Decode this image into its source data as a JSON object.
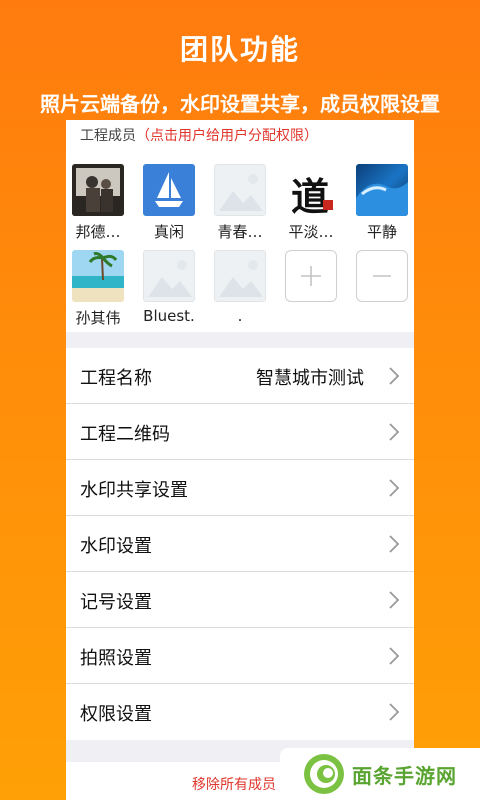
{
  "promo": {
    "title": "团队功能",
    "subtitle": "照片云端备份，水印设置共享，成员权限设置"
  },
  "members": {
    "header_label": "工程成员",
    "header_hint": "（点击用户给用户分配权限）",
    "list": [
      {
        "name": "邦德…",
        "avatar": "photo-dark"
      },
      {
        "name": "真闲",
        "avatar": "sailboat"
      },
      {
        "name": "青春…",
        "avatar": "placeholder"
      },
      {
        "name": "平淡…",
        "avatar": "calligraphy"
      },
      {
        "name": "平静",
        "avatar": "wave"
      },
      {
        "name": "孙其伟",
        "avatar": "beach"
      },
      {
        "name": "Bluest.",
        "avatar": "placeholder"
      },
      {
        "name": ".",
        "avatar": "placeholder"
      }
    ],
    "calligraphy_char": "道",
    "add_symbol": "+",
    "remove_symbol": "−"
  },
  "settings": {
    "rows": [
      {
        "label": "工程名称",
        "value": "智慧城市测试"
      },
      {
        "label": "工程二维码",
        "value": ""
      },
      {
        "label": "水印共享设置",
        "value": ""
      },
      {
        "label": "水印设置",
        "value": ""
      },
      {
        "label": "记号设置",
        "value": ""
      },
      {
        "label": "拍照设置",
        "value": ""
      },
      {
        "label": "权限设置",
        "value": ""
      }
    ]
  },
  "footer": {
    "remove_all": "移除所有成员"
  },
  "watermark": {
    "text": "面条手游网"
  },
  "colors": {
    "accent": "#ff8a0a",
    "danger": "#e0362c",
    "sail_bg": "#3b80d8",
    "brand_green": "#5aa531"
  }
}
